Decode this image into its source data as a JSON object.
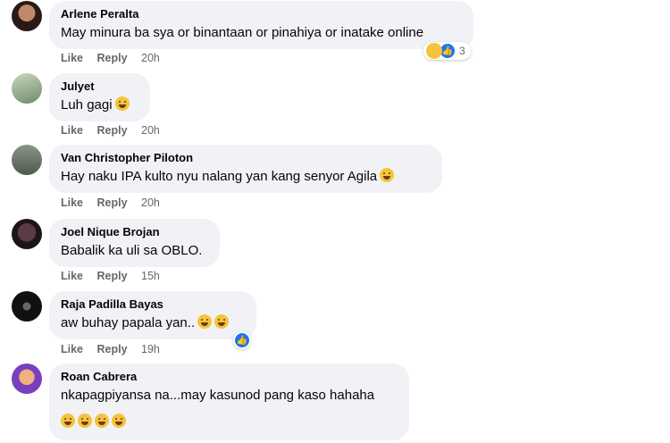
{
  "actions": {
    "like": "Like",
    "reply": "Reply"
  },
  "comments": [
    {
      "name": "Arlene Peralta",
      "text": "May minura ba sya or binantaan or pinahiya or inatake online",
      "time": "20h",
      "reaction_count": "3"
    },
    {
      "name": "Julyet",
      "text": "Luh gagi",
      "time": "20h"
    },
    {
      "name": "Van Christopher Piloton",
      "text": "Hay naku IPA kulto nyu nalang yan kang senyor Agila",
      "time": "20h"
    },
    {
      "name": "Joel Nique Brojan",
      "text": "Babalik ka uli sa OBLO.",
      "time": "15h"
    },
    {
      "name": "Raja Padilla Bayas",
      "text": "aw buhay papala yan..",
      "time": "19h"
    },
    {
      "name": "Roan Cabrera",
      "text": "nkapagpiyansa na...may kasunod pang kaso hahaha"
    }
  ],
  "colors": {
    "bubble": "#f0f2f5",
    "meta": "#65676b",
    "like_blue": "#1877f2"
  }
}
